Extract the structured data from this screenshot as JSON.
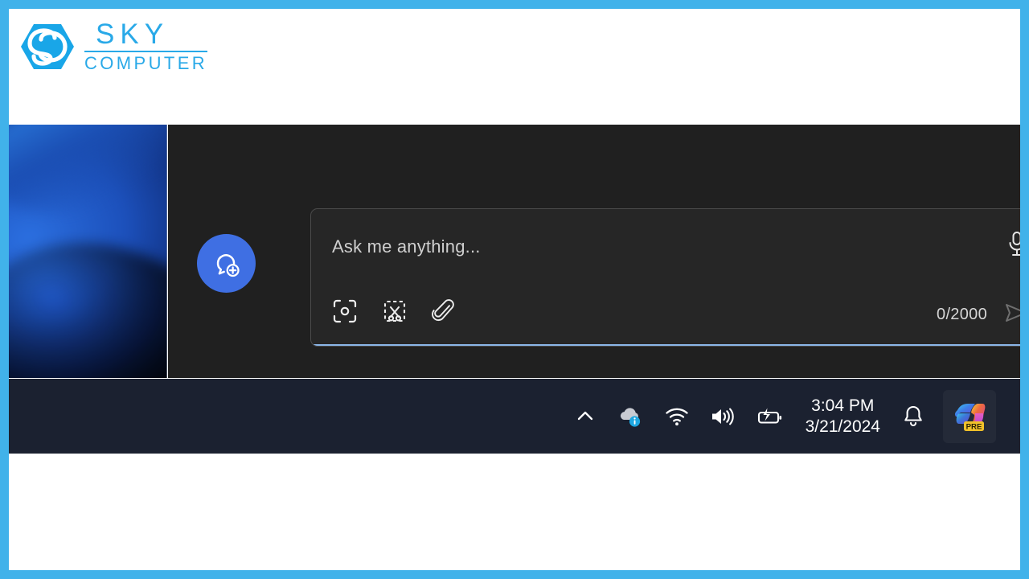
{
  "brand": {
    "logo_icon": "hexagon-s-logo-icon",
    "name_top": "SKY",
    "name_bottom": "COMPUTER",
    "accent_color": "#29a9e8"
  },
  "frame": {
    "border_color": "#41b2ea"
  },
  "desktop": {
    "wallpaper_name": "windows-11-bloom-wallpaper",
    "wallpaper_colors": [
      "#2b6fe0",
      "#1c50bb",
      "#0e2a74",
      "#030713"
    ]
  },
  "copilot": {
    "panel_background": "#202020",
    "new_chat": {
      "icon": "new-chat-bubble-plus-icon",
      "color": "#3f6fe3"
    },
    "composer": {
      "placeholder": "Ask me anything...",
      "value": "",
      "char_count": "0/2000",
      "underline_color": "#8bb6e8",
      "mic_icon": "microphone-icon",
      "send_icon": "send-paper-plane-icon",
      "tools": [
        {
          "icon": "scan-lens-icon",
          "name": "visual-search"
        },
        {
          "icon": "snip-scissors-icon",
          "name": "snipping-tool"
        },
        {
          "icon": "paperclip-icon",
          "name": "attach-file"
        }
      ]
    }
  },
  "taskbar": {
    "background": "#1b2130",
    "tray": [
      {
        "icon": "chevron-up-icon",
        "name": "show-hidden-icons"
      },
      {
        "icon": "onedrive-cloud-info-icon",
        "name": "onedrive-status"
      },
      {
        "icon": "wifi-icon",
        "name": "network"
      },
      {
        "icon": "speaker-icon",
        "name": "volume"
      },
      {
        "icon": "battery-charging-icon",
        "name": "battery"
      }
    ],
    "clock": {
      "time": "3:04 PM",
      "date": "3/21/2024"
    },
    "notification_icon": "bell-icon",
    "copilot_button": {
      "icon": "copilot-icon",
      "badge": "PRE"
    }
  }
}
